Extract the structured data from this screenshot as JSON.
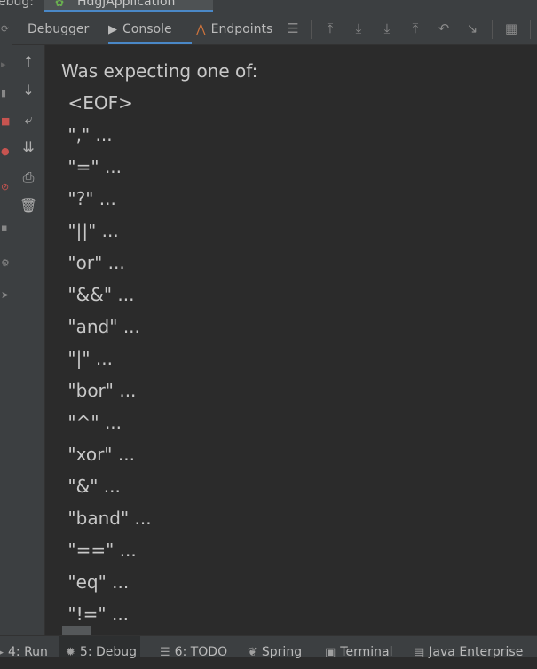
{
  "titlebar": {
    "left_label": "ebug:",
    "run_config": "HdgjApplication"
  },
  "toolbar": {
    "tabs": [
      {
        "label": "Debugger",
        "icon": "none"
      },
      {
        "label": "Console",
        "icon": "console-icon"
      },
      {
        "label": "Endpoints",
        "icon": "endpoints-icon"
      }
    ],
    "active_tab": "Console"
  },
  "console": {
    "lines": [
      "Was expecting one of:",
      "    <EOF>",
      "    \",\" ...",
      "    \"=\" ...",
      "    \"?\" ...",
      "    \"||\" ...",
      "    \"or\" ...",
      "    \"&&\" ...",
      "    \"and\" ...",
      "    \"|\" ...",
      "    \"bor\" ...",
      "    \"^\" ...",
      "    \"xor\" ...",
      "    \"&\" ...",
      "    \"band\" ...",
      "    \"==\" ...",
      "    \"eq\" ...",
      "    \"!=\" ..."
    ]
  },
  "bottom_bar": {
    "tabs": [
      {
        "label": "4: Run",
        "icon": "run-icon"
      },
      {
        "label": "5: Debug",
        "icon": "debug-icon"
      },
      {
        "label": "6: TODO",
        "icon": "todo-list-icon"
      },
      {
        "label": "Spring",
        "icon": "spring-leaf-icon"
      },
      {
        "label": "Terminal",
        "icon": "terminal-icon"
      },
      {
        "label": "Java Enterprise",
        "icon": "java-enterprise-icon"
      }
    ],
    "active_tab": "5: Debug"
  },
  "colors": {
    "background": "#2b2b2b",
    "panel": "#3c3f41",
    "accent": "#4a88c7",
    "text": "#c8c8c8"
  }
}
